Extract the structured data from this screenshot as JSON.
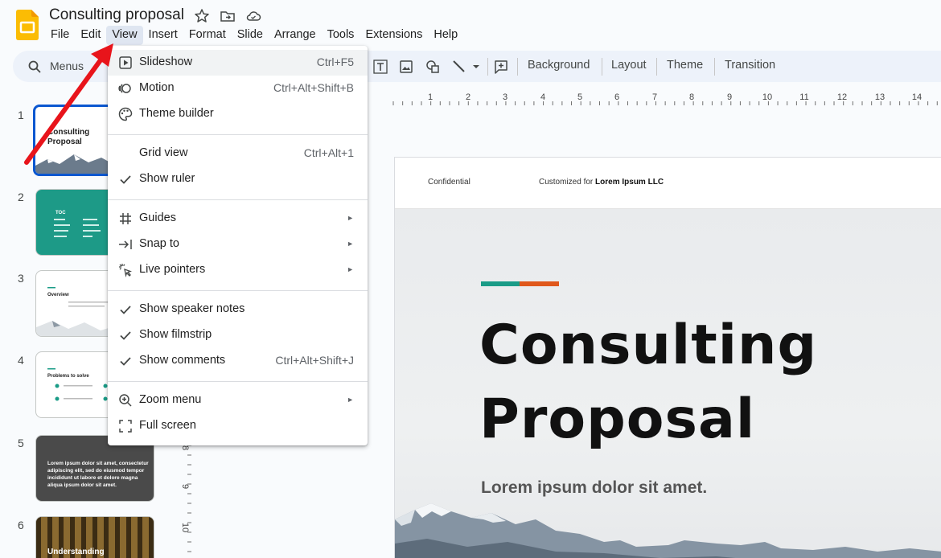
{
  "app": {
    "doc_title": "Consulting proposal",
    "colors": {
      "accent_blue": "#0b57d0",
      "app_yellow": "#fbbc04",
      "teal": "#1a9c87",
      "orange": "#e0581b",
      "annotation_red": "#e8141b"
    }
  },
  "menubar": [
    "File",
    "Edit",
    "View",
    "Insert",
    "Format",
    "Slide",
    "Arrange",
    "Tools",
    "Extensions",
    "Help"
  ],
  "toolbar": {
    "search_label": "Menus",
    "buttons": [
      "Background",
      "Layout",
      "Theme",
      "Transition"
    ]
  },
  "view_menu": {
    "items": [
      {
        "label": "Slideshow",
        "shortcut": "Ctrl+F5",
        "icon": "play-box-icon"
      },
      {
        "label": "Motion",
        "shortcut": "Ctrl+Alt+Shift+B",
        "icon": "motion-icon"
      },
      {
        "label": "Theme builder",
        "shortcut": "",
        "icon": "palette-icon"
      },
      {
        "label": "Grid view",
        "shortcut": "Ctrl+Alt+1",
        "icon": ""
      },
      {
        "label": "Show ruler",
        "shortcut": "",
        "icon": "check-icon"
      },
      {
        "label": "Guides",
        "shortcut": "",
        "icon": "grid-hash-icon"
      },
      {
        "label": "Snap to",
        "shortcut": "",
        "icon": "snap-arrow-icon"
      },
      {
        "label": "Live pointers",
        "shortcut": "",
        "icon": "pointer-sparkle-icon"
      },
      {
        "label": "Show speaker notes",
        "shortcut": "",
        "icon": "check-icon"
      },
      {
        "label": "Show filmstrip",
        "shortcut": "",
        "icon": "check-icon"
      },
      {
        "label": "Show comments",
        "shortcut": "Ctrl+Alt+Shift+J",
        "icon": "check-icon"
      },
      {
        "label": "Zoom menu",
        "shortcut": "",
        "icon": "zoom-in-icon"
      },
      {
        "label": "Full screen",
        "shortcut": "",
        "icon": "fullscreen-icon"
      }
    ]
  },
  "filmstrip": {
    "numbers": [
      "1",
      "2",
      "3",
      "4",
      "5",
      "6"
    ],
    "thumb1_title": "Consulting Proposal",
    "thumb2_title": "TOC",
    "thumb3_title": "Overview",
    "thumb4_title": "Problems to solve",
    "thumb5_text": "Lorem ipsum dolor sit amet, consectetur adipiscing elit, sed do eiusmod tempor incididunt ut labore et dolore magna aliqua ipsum dolor sit amet.",
    "thumb6_title": "Understanding"
  },
  "ruler": {
    "h_labels": [
      "1",
      "2",
      "3",
      "4",
      "5",
      "6",
      "7",
      "8",
      "9",
      "10",
      "11",
      "12",
      "13",
      "14"
    ],
    "v_labels": [
      "8",
      "9",
      "10"
    ]
  },
  "slide": {
    "header_left": "Confidential",
    "header_prefix": "Customized for",
    "header_client": "Lorem Ipsum LLC",
    "title_line1": "Consulting",
    "title_line2": "Proposal",
    "subtitle": "Lorem ipsum dolor sit amet."
  }
}
